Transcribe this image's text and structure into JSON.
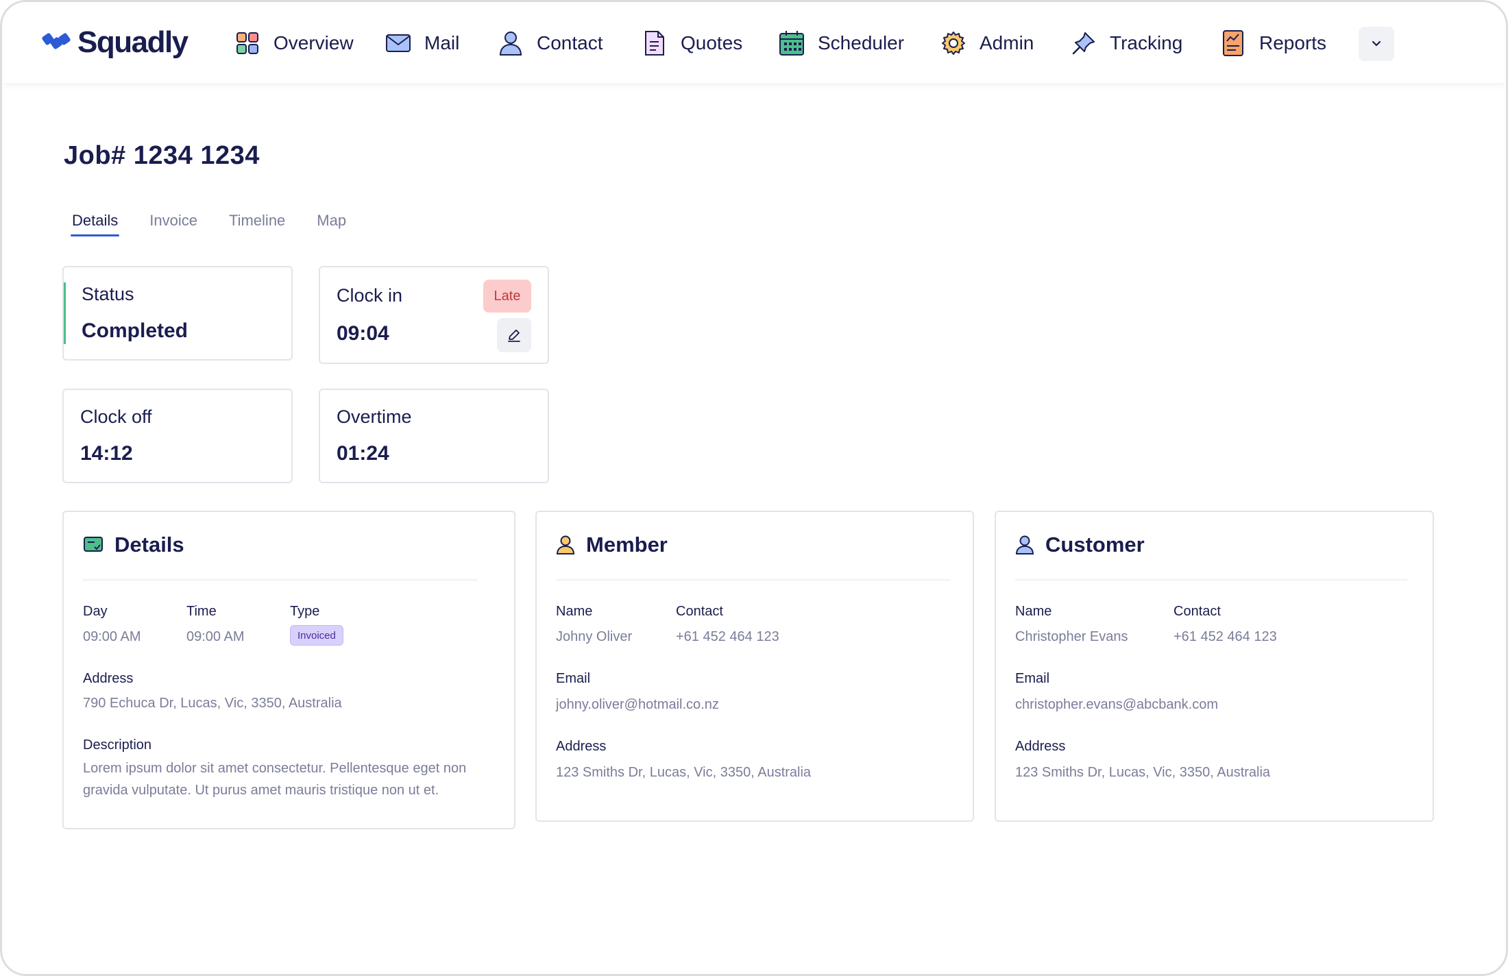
{
  "brand": {
    "name": "Squadly",
    "logo_icon": "squadly-logo-icon",
    "color": "#2c5bd6"
  },
  "nav": {
    "items": [
      {
        "label": "Overview",
        "icon": "overview-grid-icon"
      },
      {
        "label": "Mail",
        "icon": "mail-icon"
      },
      {
        "label": "Contact",
        "icon": "contact-person-icon"
      },
      {
        "label": "Quotes",
        "icon": "quotes-document-icon"
      },
      {
        "label": "Scheduler",
        "icon": "scheduler-calendar-icon"
      },
      {
        "label": "Admin",
        "icon": "admin-gear-icon"
      },
      {
        "label": "Tracking",
        "icon": "tracking-pin-icon"
      },
      {
        "label": "Reports",
        "icon": "reports-chart-icon"
      }
    ],
    "more_icon": "chevron-down-icon"
  },
  "page": {
    "title": "Job# 1234 1234"
  },
  "tabs": [
    {
      "label": "Details",
      "active": true
    },
    {
      "label": "Invoice",
      "active": false
    },
    {
      "label": "Timeline",
      "active": false
    },
    {
      "label": "Map",
      "active": false
    }
  ],
  "stats": {
    "status": {
      "label": "Status",
      "value": "Completed",
      "accent": "#4dbf8a"
    },
    "clock_in": {
      "label": "Clock in",
      "value": "09:04",
      "badge": "Late",
      "badge_color": "#fccbcb"
    },
    "clock_off": {
      "label": "Clock off",
      "value": "14:12"
    },
    "overtime": {
      "label": "Overtime",
      "value": "01:24"
    }
  },
  "details": {
    "title": "Details",
    "day_label": "Day",
    "day_value": "09:00 AM",
    "time_label": "Time",
    "time_value": "09:00 AM",
    "type_label": "Type",
    "type_value": "Invoiced",
    "address_label": "Address",
    "address_value": "790 Echuca Dr, Lucas, Vic, 3350, Australia",
    "description_label": "Description",
    "description_value": "Lorem ipsum dolor sit amet consectetur. Pellentesque eget non gravida vulputate. Ut purus amet mauris tristique non ut et."
  },
  "member": {
    "title": "Member",
    "name_label": "Name",
    "name_value": "Johny Oliver",
    "contact_label": "Contact",
    "contact_value": "+61 452 464 123",
    "email_label": "Email",
    "email_value": "johny.oliver@hotmail.co.nz",
    "address_label": "Address",
    "address_value": "123 Smiths Dr, Lucas, Vic, 3350, Australia"
  },
  "customer": {
    "title": "Customer",
    "name_label": "Name",
    "name_value": "Christopher Evans",
    "contact_label": "Contact",
    "contact_value": "+61 452 464 123",
    "email_label": "Email",
    "email_value": "christopher.evans@abcbank.com",
    "address_label": "Address",
    "address_value": "123 Smiths Dr, Lucas, Vic, 3350, Australia"
  }
}
